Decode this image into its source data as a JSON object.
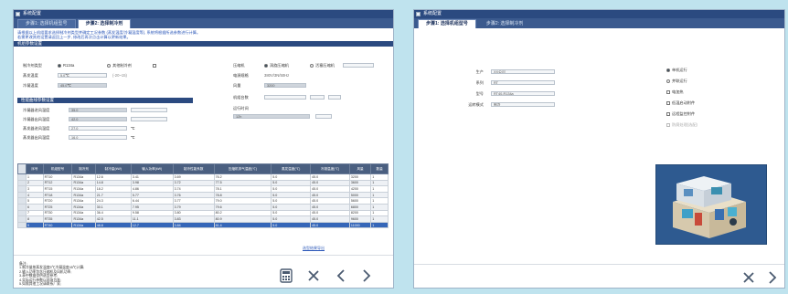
{
  "left_window": {
    "title": "系统配置",
    "tabs": [
      "步骤1: 选择机组型号",
      "步骤2: 选择制冷剂"
    ],
    "active_tab": 1,
    "info_lines": [
      "请根据以上机组要求选择制冷剂类型并确定工况参数 (蒸发温度/冷凝温度等), 系统将根据所选参数进行计算。",
      "若需更改其他设置请返回上一步, 修改后再次点击计算以更新结果。"
    ],
    "section_main": "机组参数设置",
    "left_fields": [
      {
        "label": "制冷剂类型",
        "value": "R134a",
        "option": "其他制冷剂"
      },
      {
        "label": "蒸发温度",
        "value": "5.0℃",
        "hint": "(-20~15)"
      },
      {
        "label": "冷凝温度",
        "value": "45.0℃",
        "hint": ""
      }
    ],
    "right_fields": [
      {
        "label": "压缩机",
        "value": "涡旋压缩机",
        "option": "活塞压缩机"
      },
      {
        "label": "电源规格",
        "value": "380V/3N/50Hz"
      },
      {
        "label": "风量",
        "value": "3200"
      },
      {
        "label": "机组台数",
        "value": ""
      },
      {
        "label": "运行时间",
        "value": "12h"
      }
    ],
    "section_sub": "性能曲线参数设置",
    "sub_fields": [
      {
        "label": "冷凝器进风温度",
        "value": "35.0"
      },
      {
        "label": "冷凝器出风温度",
        "value": "42.0"
      },
      {
        "label": "蒸发器进风温度",
        "value": "27.0",
        "unit": "℃"
      },
      {
        "label": "蒸发器出风温度",
        "value": "16.0",
        "unit": "℃"
      }
    ],
    "table": {
      "headers": [
        "序号",
        "机组型号",
        "制冷剂",
        "制冷量(kW)",
        "输入功率(kW)",
        "制冷性能系数",
        "压缩机排气温度(℃)",
        "蒸发温度(℃)",
        "冷凝温度(℃)",
        "风量",
        "数量"
      ],
      "rows": [
        [
          "1",
          "RT10",
          "R134a",
          "12.6",
          "3.41",
          "3.69",
          "76.2",
          "5.0",
          "45.0",
          "3200",
          "1"
        ],
        [
          "2",
          "RT12",
          "R134a",
          "14.8",
          "3.98",
          "3.72",
          "77.5",
          "5.0",
          "45.0",
          "3600",
          "1"
        ],
        [
          "3",
          "RT15",
          "R134a",
          "18.2",
          "4.86",
          "3.74",
          "78.1",
          "5.0",
          "45.0",
          "4200",
          "1"
        ],
        [
          "4",
          "RT18",
          "R134a",
          "21.7",
          "5.77",
          "3.76",
          "78.8",
          "5.0",
          "45.0",
          "5000",
          "1"
        ],
        [
          "5",
          "RT20",
          "R134a",
          "24.3",
          "6.44",
          "3.77",
          "79.0",
          "5.0",
          "45.0",
          "5600",
          "1"
        ],
        [
          "6",
          "RT25",
          "R134a",
          "30.1",
          "7.95",
          "3.79",
          "79.6",
          "5.0",
          "45.0",
          "6800",
          "1"
        ],
        [
          "7",
          "RT30",
          "R134a",
          "36.4",
          "9.58",
          "3.80",
          "80.2",
          "5.0",
          "45.0",
          "8200",
          "1"
        ],
        [
          "8",
          "RT35",
          "R134a",
          "42.5",
          "11.1",
          "3.83",
          "80.9",
          "5.0",
          "45.0",
          "9600",
          "1"
        ],
        [
          "9",
          "RT40",
          "R134a",
          "48.8",
          "12.7",
          "3.84",
          "81.4",
          "5.0",
          "45.0",
          "11000",
          "1"
        ]
      ],
      "selected_row": 8
    },
    "notes": [
      "备注:",
      "1.制冷量按蒸发温度5℃冷凝温度45℃计算;",
      "2.输入功率包含压缩机及风机功率;",
      "3.表中数据仅供选型参考;",
      "4.实际运行参数以现场为准;",
      "5.如需其他工况请联系厂家;",
      "6.选型结果可导出。"
    ],
    "link_text": "选型结果导出"
  },
  "right_window": {
    "title": "系统配置",
    "tabs": [
      "步骤1: 选择机组型号",
      "步骤2: 选择制冷剂"
    ],
    "active_tab": 0,
    "fields": [
      {
        "label": "生产",
        "value": "XX公司"
      },
      {
        "label": "系列",
        "value": "RT"
      },
      {
        "label": "型号",
        "value": "RT40-R134a"
      },
      {
        "label": "运转模式",
        "value": "制冷"
      }
    ],
    "options": [
      {
        "label": "单机运行",
        "type": "radio",
        "checked": true
      },
      {
        "label": "并联运行",
        "type": "radio",
        "checked": false
      },
      {
        "label": "电加热",
        "type": "check",
        "checked": false
      },
      {
        "label": "低温启动附件",
        "type": "check",
        "checked": false
      },
      {
        "label": "远程监控附件",
        "type": "check",
        "checked": false
      },
      {
        "label": "防腐处理(选配)",
        "type": "check",
        "checked": false,
        "disabled": true
      }
    ]
  },
  "icons": {
    "calculator": "calculator-icon",
    "cancel": "close-icon",
    "prev": "chevron-left-icon",
    "next": "chevron-right-icon"
  },
  "colors": {
    "title_bar": "#2b4a80",
    "selected_row": "#3566b8",
    "page_background": "#bfe3ee"
  }
}
